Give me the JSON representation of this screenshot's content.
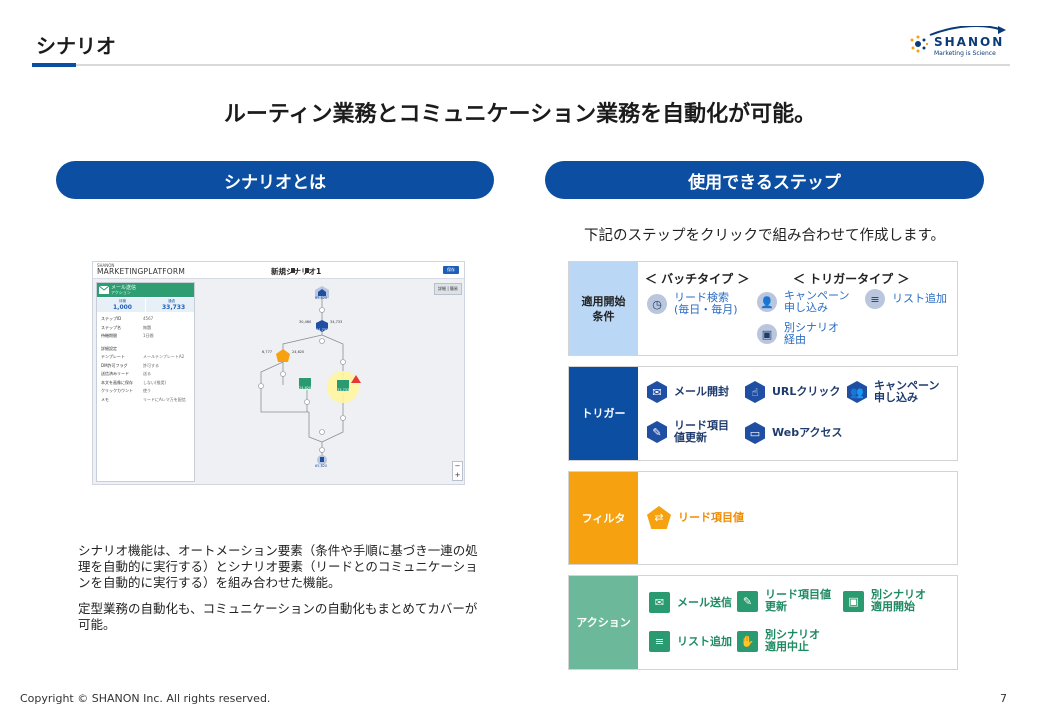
{
  "header": {
    "title": "シナリオ",
    "logo": {
      "name": "SHANON",
      "tagline": "Marketing is Science",
      "icon": "shanon-logo-icon"
    }
  },
  "headline": "ルーティン業務とコミュニケーション業務を自動化が可能。",
  "left": {
    "pill": "シナリオとは",
    "screenshot": {
      "brand_small": "SHANON",
      "brand": "MARKETINGPLATFORM",
      "scenario_title": "新規シナリオ1",
      "save": "保存",
      "view_toggle": "詳細 | 簡易",
      "panel": {
        "title": "メール送信",
        "subtitle": "アクション",
        "stat_left_label": "待機",
        "stat_left_value": "1,000",
        "stat_right_label": "通過",
        "stat_right_value": "33,733",
        "rows": [
          {
            "label": "ステップID",
            "value": "4567"
          },
          {
            "label": "ステップ名",
            "value": "無題"
          },
          {
            "label": "待機期間",
            "value": "1日間"
          },
          {
            "label": "詳細設定",
            "value": ""
          },
          {
            "label": "テンプレート",
            "value": "メールテンプレートA2"
          },
          {
            "label": "DM許可フラグ",
            "value": "許可する"
          },
          {
            "label": "送信済みリード",
            "value": "送る"
          },
          {
            "label": "本文を画像に保存",
            "value": "しない(推奨)"
          },
          {
            "label": "クリックカウント",
            "value": "使う"
          },
          {
            "label": "メモ",
            "value": "リードにAレマ万を配信"
          }
        ]
      },
      "counts": {
        "start": "65,820",
        "trigger_a": "30,460",
        "trigger_b": "34,733",
        "trigger_c": "34,733",
        "filter_a": "6,777",
        "filter_b": "24,620",
        "mail_a": "24,620",
        "mail_b": "33,733",
        "end": "65,820"
      }
    },
    "description": [
      "シナリオ機能は、オートメーション要素（条件や手順に基づき一連の処理を自動的に実行する）とシナリオ要素（リードとのコミュニケーションを自動的に実行する）を組み合わせた機能。",
      "定型業務の自動化も、コミュニケーションの自動化もまとめてカバーが可能。"
    ]
  },
  "right": {
    "pill": "使用できるステップ",
    "intro": "下記のステップをクリックで組み合わせて作成します。",
    "start_condition": {
      "label": "適用開始\n条件",
      "batch_heading": "＜ バッチタイプ ＞",
      "trigger_heading": "＜ トリガータイプ ＞",
      "items": [
        {
          "icon": "clock-icon",
          "label": "リード検索\n(毎日・毎月)"
        },
        {
          "icon": "person-add-icon",
          "label": "キャンペーン\n申し込み"
        },
        {
          "icon": "list-add-icon",
          "label": "リスト追加"
        },
        {
          "icon": "scenario-play-icon",
          "label": "別シナリオ\n経由"
        }
      ]
    },
    "trigger": {
      "label": "トリガー",
      "items": [
        {
          "icon": "mail-open-icon",
          "label": "メール開封"
        },
        {
          "icon": "pointer-click-icon",
          "label": "URLクリック"
        },
        {
          "icon": "campaign-icon",
          "label": "キャンペーン\n申し込み"
        },
        {
          "icon": "pencil-icon",
          "label": "リード項目\n値更新"
        },
        {
          "icon": "monitor-icon",
          "label": "Webアクセス"
        }
      ]
    },
    "filter": {
      "label": "フィルタ",
      "items": [
        {
          "icon": "filter-icon",
          "label": "リード項目値"
        }
      ]
    },
    "action": {
      "label": "アクション",
      "items": [
        {
          "icon": "mail-icon",
          "label": "メール送信"
        },
        {
          "icon": "pencil-icon",
          "label": "リード項目値\n更新"
        },
        {
          "icon": "scenario-start-icon",
          "label": "別シナリオ\n適用開始"
        },
        {
          "icon": "list-add-icon",
          "label": "リスト追加"
        },
        {
          "icon": "hand-stop-icon",
          "label": "別シナリオ\n適用中止"
        }
      ]
    }
  },
  "footer": {
    "copyright": "Copyright © SHANON Inc. All rights reserved.",
    "page_number": "7"
  },
  "colors": {
    "primary_blue": "#0b4ea2",
    "light_blue": "#bad8f6",
    "orange": "#f5a110",
    "green": "#6cb89b"
  }
}
